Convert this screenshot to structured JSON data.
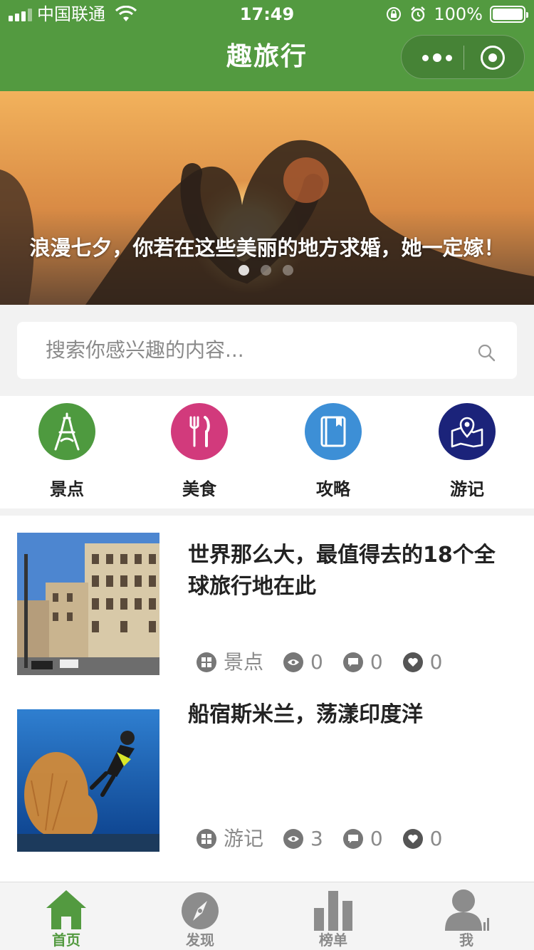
{
  "status_bar": {
    "carrier": "中国联通",
    "time": "17:49",
    "battery": "100%"
  },
  "nav": {
    "title": "趣旅行"
  },
  "banner": {
    "caption": "浪漫七夕，你若在这些美丽的地方求婚，她一定嫁！",
    "slide_count": 3,
    "active_slide": 1
  },
  "search": {
    "placeholder": "搜索你感兴趣的内容..."
  },
  "categories": [
    {
      "label": "景点",
      "icon": "eiffel-tower-icon",
      "color": "#4e9a3f"
    },
    {
      "label": "美食",
      "icon": "fork-knife-icon",
      "color": "#d23a7c"
    },
    {
      "label": "攻略",
      "icon": "book-icon",
      "color": "#3d8fd6"
    },
    {
      "label": "游记",
      "icon": "map-pin-icon",
      "color": "#1b237a"
    }
  ],
  "articles": [
    {
      "title": "世界那么大，最值得去的18个全球旅行地在此",
      "category": "景点",
      "views": "0",
      "comments": "0",
      "likes": "0"
    },
    {
      "title": "船宿斯米兰，荡漾印度洋",
      "category": "游记",
      "views": "3",
      "comments": "0",
      "likes": "0"
    }
  ],
  "tabbar": [
    {
      "label": "首页",
      "icon": "home-icon"
    },
    {
      "label": "发现",
      "icon": "compass-icon"
    },
    {
      "label": "榜单",
      "icon": "bar-chart-icon"
    },
    {
      "label": "我",
      "icon": "user-icon"
    }
  ],
  "colors": {
    "brand_green": "#539a40",
    "muted_text": "#8a8a8a"
  }
}
